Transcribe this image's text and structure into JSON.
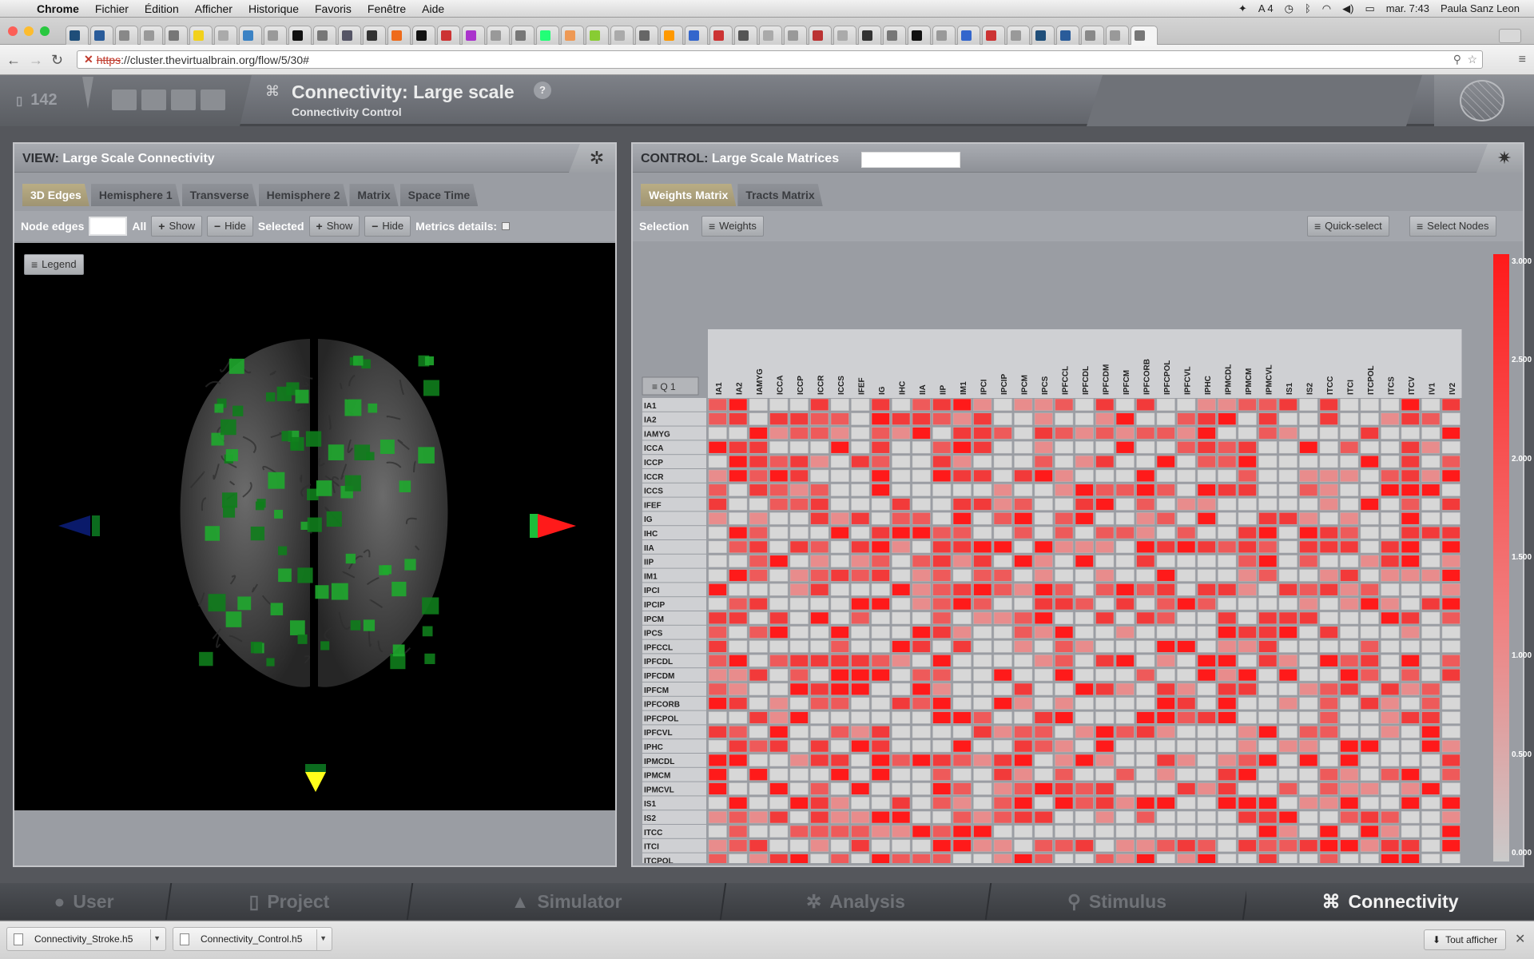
{
  "menubar": {
    "app": "Chrome",
    "items": [
      "Fichier",
      "Édition",
      "Afficher",
      "Historique",
      "Favoris",
      "Fenêtre",
      "Aide"
    ],
    "status_4": "4",
    "clock": "mar. 7:43",
    "user": "Paula Sanz Leon"
  },
  "browser": {
    "url_scheme": "https",
    "url_rest": "://cluster.thevirtualbrain.org/flow/5/30#"
  },
  "header": {
    "project_count": "142",
    "title": "Connectivity: Large scale",
    "subtitle": "Connectivity Control",
    "help": "?"
  },
  "view_panel": {
    "heading_prefix": "VIEW:",
    "heading": "Large Scale Connectivity",
    "tabs": [
      "3D Edges",
      "Hemisphere 1",
      "Transverse",
      "Hemisphere 2",
      "Matrix",
      "Space Time"
    ],
    "toolbar": {
      "node_edges": "Node edges",
      "all": "All",
      "show": "Show",
      "hide": "Hide",
      "selected": "Selected",
      "show2": "Show",
      "hide2": "Hide",
      "metrics": "Metrics details:"
    },
    "legend_btn": "Legend"
  },
  "control_panel": {
    "heading_prefix": "CONTROL:",
    "heading": "Large Scale Matrices",
    "tabs": [
      "Weights Matrix",
      "Tracts Matrix"
    ],
    "selection_label": "Selection",
    "weights_btn": "Weights",
    "quick_select": "Quick-select",
    "select_nodes": "Select Nodes",
    "quadrant_btn": "Q 1"
  },
  "chart_data": {
    "type": "heatmap",
    "title": "",
    "labels": [
      "IA1",
      "IA2",
      "IAMYG",
      "ICCA",
      "ICCP",
      "ICCR",
      "ICCS",
      "IFEF",
      "IG",
      "IHC",
      "IIA",
      "IIP",
      "IM1",
      "IPCI",
      "IPCIP",
      "IPCM",
      "IPCS",
      "IPFCCL",
      "IPFCDL",
      "IPFCDM",
      "IPFCM",
      "IPFCORB",
      "IPFCPOL",
      "IPFCVL",
      "IPHC",
      "IPMCDL",
      "IPMCM",
      "IPMCVL",
      "IS1",
      "IS2",
      "ITCC",
      "ITCI",
      "ITCPOL",
      "ITCS",
      "ITCV",
      "IV1",
      "IV2"
    ],
    "colorbar_ticks": [
      "3.000",
      "2.500",
      "2.000",
      "1.500",
      "1.000",
      "0.500",
      "0.000"
    ],
    "colorbar_range": [
      0,
      3
    ],
    "colors": {
      "high": "#ff1a1a",
      "mid": "#f08080",
      "low": "#cacaca"
    }
  },
  "bottom_nav": [
    {
      "label": "User",
      "icon": "user-icon"
    },
    {
      "label": "Project",
      "icon": "document-icon"
    },
    {
      "label": "Simulator",
      "icon": "flask-icon"
    },
    {
      "label": "Analysis",
      "icon": "gear-icon"
    },
    {
      "label": "Stimulus",
      "icon": "pin-icon"
    },
    {
      "label": "Connectivity",
      "icon": "connectivity-icon"
    }
  ],
  "downloads": {
    "files": [
      "Connectivity_Stroke.h5",
      "Connectivity_Control.h5"
    ],
    "show_all": "Tout afficher"
  }
}
